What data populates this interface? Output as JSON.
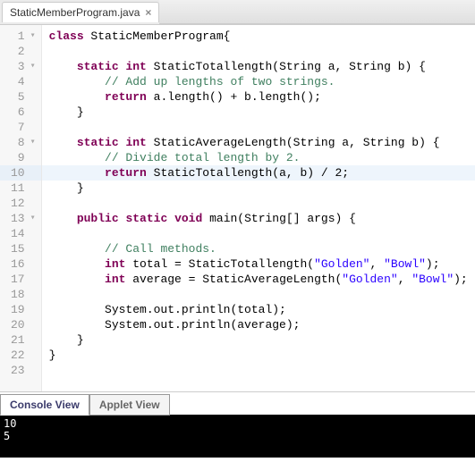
{
  "tab": {
    "filename": "StaticMemberProgram.java"
  },
  "highlight_line": 10,
  "code_lines": [
    {
      "n": 1,
      "fold": true,
      "segs": [
        [
          "kw",
          "class"
        ],
        [
          "",
          " StaticMemberProgram{"
        ]
      ]
    },
    {
      "n": 2,
      "segs": []
    },
    {
      "n": 3,
      "fold": true,
      "segs": [
        [
          "",
          "    "
        ],
        [
          "kw",
          "static"
        ],
        [
          "",
          " "
        ],
        [
          "type",
          "int"
        ],
        [
          "",
          " StaticTotallength(String a, String b) {"
        ]
      ]
    },
    {
      "n": 4,
      "segs": [
        [
          "",
          "        "
        ],
        [
          "cmt",
          "// Add up lengths of two strings."
        ]
      ]
    },
    {
      "n": 5,
      "segs": [
        [
          "",
          "        "
        ],
        [
          "kw",
          "return"
        ],
        [
          "",
          " a.length() + b.length();"
        ]
      ]
    },
    {
      "n": 6,
      "segs": [
        [
          "",
          "    }"
        ]
      ]
    },
    {
      "n": 7,
      "segs": []
    },
    {
      "n": 8,
      "fold": true,
      "segs": [
        [
          "",
          "    "
        ],
        [
          "kw",
          "static"
        ],
        [
          "",
          " "
        ],
        [
          "type",
          "int"
        ],
        [
          "",
          " StaticAverageLength(String a, String b) {"
        ]
      ]
    },
    {
      "n": 9,
      "segs": [
        [
          "",
          "        "
        ],
        [
          "cmt",
          "// Divide total length by 2."
        ]
      ]
    },
    {
      "n": 10,
      "segs": [
        [
          "",
          "        "
        ],
        [
          "kw",
          "return"
        ],
        [
          "",
          " StaticTotallength(a, b) / 2;"
        ]
      ]
    },
    {
      "n": 11,
      "segs": [
        [
          "",
          "    }"
        ]
      ]
    },
    {
      "n": 12,
      "segs": []
    },
    {
      "n": 13,
      "fold": true,
      "segs": [
        [
          "",
          "    "
        ],
        [
          "kw",
          "public"
        ],
        [
          "",
          " "
        ],
        [
          "kw",
          "static"
        ],
        [
          "",
          " "
        ],
        [
          "type",
          "void"
        ],
        [
          "",
          " main(String[] args) {"
        ]
      ]
    },
    {
      "n": 14,
      "segs": []
    },
    {
      "n": 15,
      "segs": [
        [
          "",
          "        "
        ],
        [
          "cmt",
          "// Call methods."
        ]
      ]
    },
    {
      "n": 16,
      "segs": [
        [
          "",
          "        "
        ],
        [
          "type",
          "int"
        ],
        [
          "",
          " total = StaticTotallength("
        ],
        [
          "str",
          "\"Golden\""
        ],
        [
          "",
          ", "
        ],
        [
          "str",
          "\"Bowl\""
        ],
        [
          "",
          ");"
        ]
      ]
    },
    {
      "n": 17,
      "segs": [
        [
          "",
          "        "
        ],
        [
          "type",
          "int"
        ],
        [
          "",
          " average = StaticAverageLength("
        ],
        [
          "str",
          "\"Golden\""
        ],
        [
          "",
          ", "
        ],
        [
          "str",
          "\"Bowl\""
        ],
        [
          "",
          ");"
        ]
      ]
    },
    {
      "n": 18,
      "segs": []
    },
    {
      "n": 19,
      "segs": [
        [
          "",
          "        System.out.println(total);"
        ]
      ]
    },
    {
      "n": 20,
      "segs": [
        [
          "",
          "        System.out.println(average);"
        ]
      ]
    },
    {
      "n": 21,
      "segs": [
        [
          "",
          "    }"
        ]
      ]
    },
    {
      "n": 22,
      "segs": [
        [
          "",
          "}"
        ]
      ]
    },
    {
      "n": 23,
      "segs": []
    }
  ],
  "console_tabs": {
    "active": "Console View",
    "inactive": "Applet View"
  },
  "console_output": "10\n5"
}
